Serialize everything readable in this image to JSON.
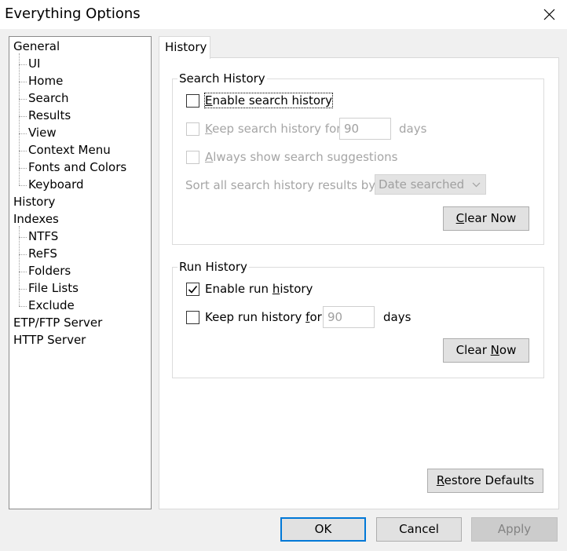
{
  "window": {
    "title": "Everything Options"
  },
  "tree": {
    "items": [
      {
        "label": "General",
        "level": 0
      },
      {
        "label": "UI",
        "level": 1
      },
      {
        "label": "Home",
        "level": 1
      },
      {
        "label": "Search",
        "level": 1
      },
      {
        "label": "Results",
        "level": 1
      },
      {
        "label": "View",
        "level": 1
      },
      {
        "label": "Context Menu",
        "level": 1
      },
      {
        "label": "Fonts and Colors",
        "level": 1
      },
      {
        "label": "Keyboard",
        "level": 1
      },
      {
        "label": "History",
        "level": 0,
        "selected": true
      },
      {
        "label": "Indexes",
        "level": 0
      },
      {
        "label": "NTFS",
        "level": 1
      },
      {
        "label": "ReFS",
        "level": 1
      },
      {
        "label": "Folders",
        "level": 1
      },
      {
        "label": "File Lists",
        "level": 1
      },
      {
        "label": "Exclude",
        "level": 1
      },
      {
        "label": "ETP/FTP Server",
        "level": 0
      },
      {
        "label": "HTTP Server",
        "level": 0
      }
    ]
  },
  "tab": {
    "label": "History"
  },
  "search_history": {
    "legend": "Search History",
    "enable": {
      "label_accel": "E",
      "label_rest": "nable search history",
      "checked": false
    },
    "keep": {
      "label_accel": "K",
      "label_rest": "eep search history for",
      "value": "90",
      "unit": "days",
      "checked": false,
      "enabled": false
    },
    "always": {
      "label_accel": "A",
      "label_rest": "lways show search suggestions",
      "checked": false,
      "enabled": false
    },
    "sort": {
      "label": "Sort all search history results by:",
      "selected": "Date searched"
    },
    "clear": {
      "label_accel": "C",
      "label_rest": "lear Now"
    }
  },
  "run_history": {
    "legend": "Run History",
    "enable": {
      "label_pre": "Enable run ",
      "label_accel": "h",
      "label_rest": "istory",
      "checked": true
    },
    "keep": {
      "label_pre": "Keep run history ",
      "label_accel": "f",
      "label_rest": "or",
      "value": "90",
      "unit": "days",
      "checked": false
    },
    "clear": {
      "label_pre": "Clear ",
      "label_accel": "N",
      "label_rest": "ow"
    }
  },
  "restore": {
    "label_accel": "R",
    "label_rest": "estore Defaults"
  },
  "footer": {
    "ok": "OK",
    "cancel": "Cancel",
    "apply": "Apply"
  }
}
